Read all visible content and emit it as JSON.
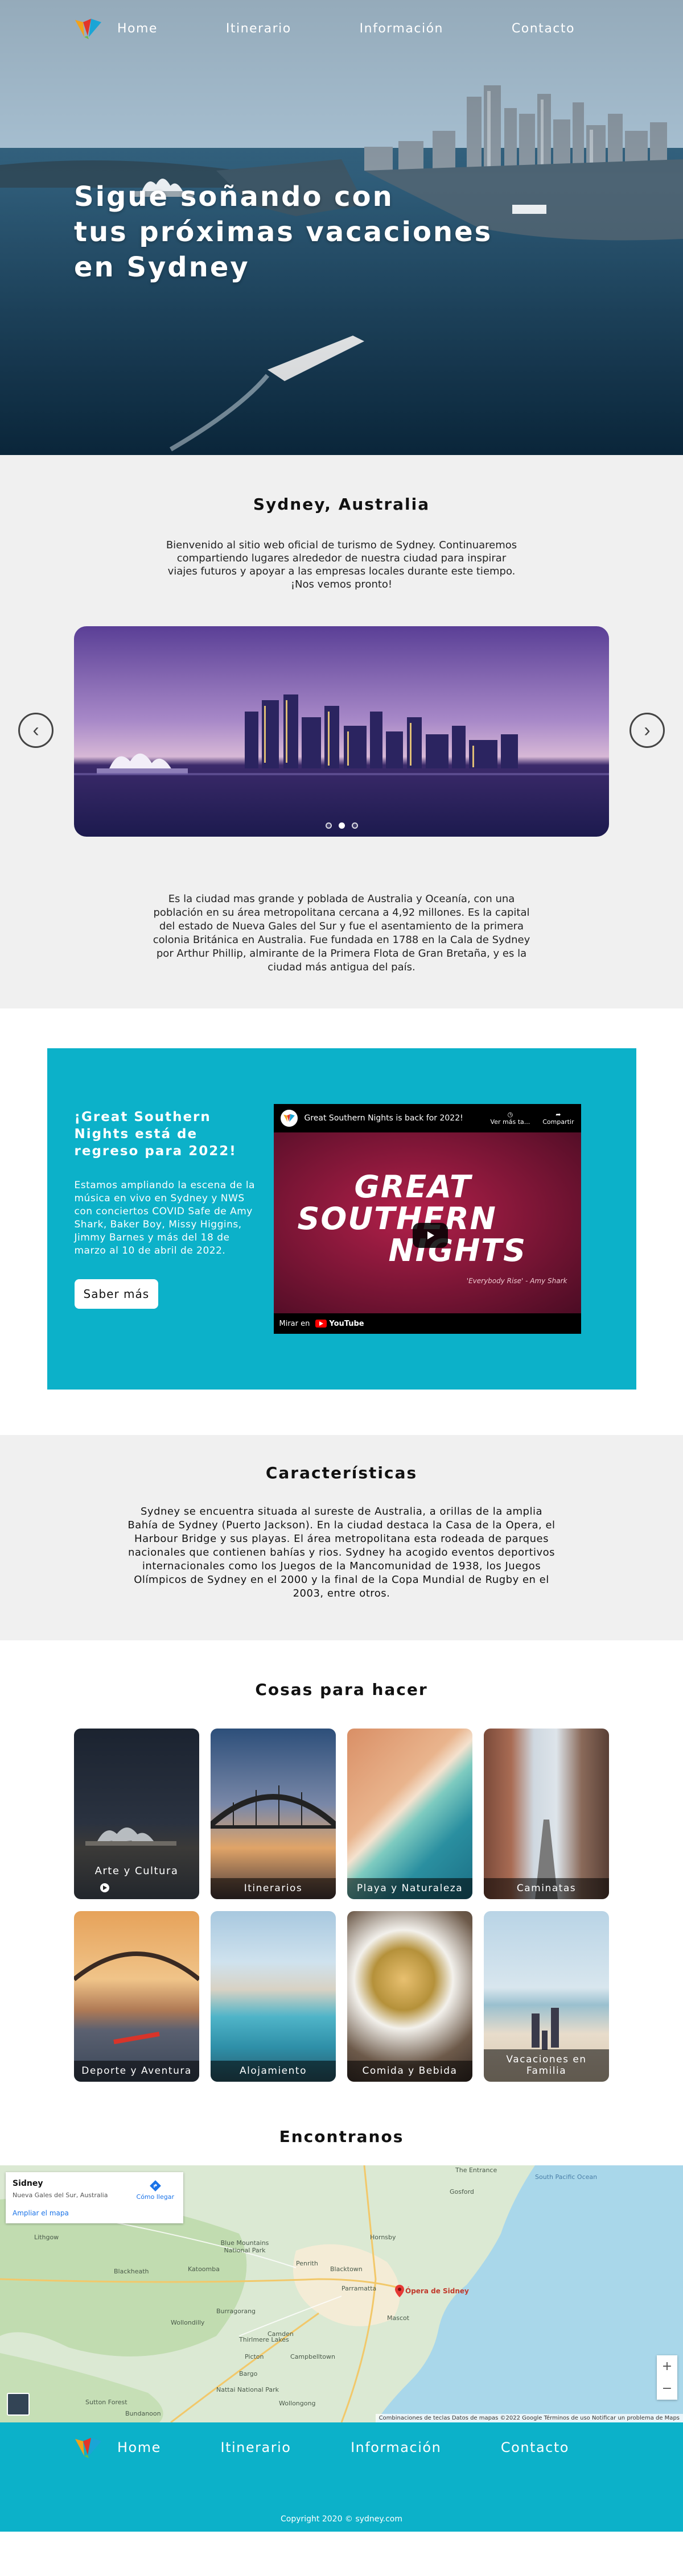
{
  "nav": {
    "items": [
      "Home",
      "Itinerario",
      "Información",
      "Contacto"
    ]
  },
  "hero": {
    "title_line1": "Sigue soñando con",
    "title_line2": "tus próximas vacaciones",
    "title_line3": "en Sydney"
  },
  "intro": {
    "title": "Sydney, Australia",
    "lead": "Bienvenido al sitio web oficial de turismo de Sydney. Continuaremos compartiendo lugares alrededor de nuestra ciudad para inspirar viajes futuros y apoyar a las empresas locales durante este tiempo. ¡Nos vemos pronto!",
    "carousel": {
      "prev_icon": "chevron-left-icon",
      "next_icon": "chevron-right-icon",
      "slides": 3,
      "active": 2
    },
    "description": "Es la ciudad mas grande y poblada de Australia y Oceanía, con una población en su área metropolitana cercana a 4,92 millones. Es la capital del estado de Nueva Gales del Sur y fue el asentamiento de la primera colonia Británica en Australia. Fue fundada en 1788 en la Cala de Sydney por Arthur Phillip, almirante de la Primera Flota de Gran Bretaña, y es la ciudad más antigua del país."
  },
  "event": {
    "title": "¡Great Southern Nights está de regreso para 2022!",
    "body": "Estamos ampliando la escena de la música en vivo en Sydney y NWS con conciertos COVID Safe de Amy Shark, Baker Boy, Missy Higgins, Jimmy Barnes y más del 18 de marzo al 10 de abril de 2022.",
    "button": "Saber más",
    "video": {
      "title": "Great Southern Nights is back for 2022!",
      "watch_later": "Ver más ta...",
      "share": "Compartir",
      "poster_line1": "GREAT",
      "poster_line2": "SOUTHERN",
      "poster_line3": "NIGHTS",
      "quote": "'Everybody Rise' - Amy Shark",
      "watch_on": "Mirar en",
      "youtube": "YouTube"
    }
  },
  "features": {
    "title": "Características",
    "body": "Sydney se encuentra situada al sureste de Australia, a orillas de la amplia Bahía de Sydney (Puerto Jackson). En la ciudad destaca la Casa de la Opera, el Harbour Bridge y sus playas. El área metropolitana esta rodeada de parques nacionales que contienen bahías y rios. Sydney ha acogido eventos deportivos internacionales como los Juegos de la Mancomunidad de 1938, los Juegos Olímpicos de Sydney en el 2000 y la final de la Copa Mundial de Rugby en el 2003, entre otros."
  },
  "things": {
    "title": "Cosas para hacer",
    "cards": [
      "Arte y Cultura",
      "Itinerarios",
      "Playa y Naturaleza",
      "Caminatas",
      "Deporte y Aventura",
      "Alojamiento",
      "Comida y Bebida",
      "Vacaciones en Familia"
    ]
  },
  "find": {
    "title": "Encontranos",
    "map": {
      "place": "Sidney",
      "place_sub": "Nueva Gales del Sur, Australia",
      "larger_map": "Ampliar el mapa",
      "directions": "Cómo llegar",
      "pin_label": "Ópera de Sidney",
      "attribution": "Combinaciones de teclas   Datos de mapas ©2022 Google   Términos de uso   Notificar un problema de Maps",
      "labels": [
        "The Entrance",
        "South Pacific Ocean",
        "Gosford",
        "Blue Mountains National Park",
        "Katoomba",
        "Penrith",
        "Blacktown",
        "Parramatta",
        "Campbelltown",
        "Wollongong",
        "Bargo",
        "Picton",
        "Camden",
        "Wollondilly",
        "Hornsby",
        "Mascot",
        "Lithgow",
        "Blackheath",
        "Burragorang",
        "Nattai National Park",
        "Bundanoon",
        "Sutton Forest",
        "Thirlmere Lakes"
      ]
    }
  },
  "footer": {
    "copyright": "Copyright 2020 © sydney.com"
  },
  "colors": {
    "accent": "#0cb1c9",
    "section_gray": "#f0f0f0"
  }
}
